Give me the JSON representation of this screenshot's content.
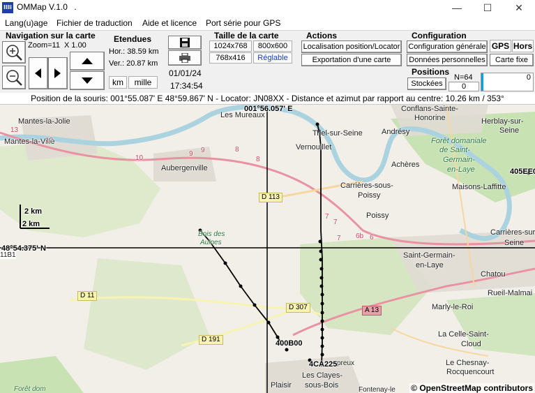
{
  "window": {
    "icon_text": "IIIi",
    "title": "OMMap V.1.0",
    "title_dot": ".",
    "minimize": "—",
    "maximize": "☐",
    "close": "✕"
  },
  "menu": {
    "items": [
      "Lang(u)age",
      "Fichier de traduction",
      "Aide et licence",
      "Port série pour GPS"
    ]
  },
  "navigation": {
    "title": "Navigation sur la carte",
    "zoom_label": "Zoom=11",
    "zoom_factor": "X 1.00",
    "zoom_in_icon": "zoom-in-icon",
    "zoom_out_icon": "zoom-out-icon"
  },
  "extents": {
    "title": "Etendues",
    "hor": "Hor.: 38.59 km",
    "ver": "Ver.: 20.87 km",
    "unit_km": "km",
    "unit_mile": "mille"
  },
  "datetime": {
    "date": "01/01/24",
    "time": "17:34:54"
  },
  "map_size": {
    "title": "Taille de la carte",
    "opt1": "1024x768",
    "opt2": "800x600",
    "opt3": "768x416",
    "opt4": "Réglable"
  },
  "actions": {
    "title": "Actions",
    "locate": "Localisation position/Locator",
    "export": "Exportation d'une carte"
  },
  "configuration": {
    "title": "Configuration",
    "general": "Configuration générale",
    "personal": "Données personnelles",
    "gps": "GPS",
    "hors": "Hors",
    "fixed": "Carte fixe"
  },
  "positions": {
    "title": "Positions",
    "stored": "Stockées",
    "count": "N=64",
    "index": "0",
    "slider_value": "0"
  },
  "infobar": {
    "text": "Position de la souris: 001°55.087' E 48°59.867' N - Locator: JN08XX - Distance et azimut par rapport au centre: 10.26 km / 353°"
  },
  "map": {
    "crosshair_lon": "001°56.057' E",
    "crosshair_lat": "48°54.375' N",
    "scale_label": "2 km",
    "copyright": "© OpenStreetMap contributors",
    "places": {
      "les_mureaux": "Les Mureaux",
      "mantes_la_jolie": "Mantes-la-Jolie",
      "mantes_la_ville": "Mantes-la-Ville",
      "aubergenville": "Aubergenville",
      "triel": "Triel-sur-Seine",
      "vernouillet": "Vernouillet",
      "andresy": "Andrésy",
      "conflans": "Conflans-Sainte-",
      "conflans2": "Honorine",
      "herblay": "Herblay-sur-",
      "herblay2": "Seine",
      "acheres": "Achères",
      "carrieres": "Carrières-sous-",
      "carrieres2": "Poissy",
      "poissy": "Poissy",
      "maisons": "Maisons-Laffitte",
      "carrieres_seine": "Carrières-sur-",
      "carrieres_seine2": "Seine",
      "st_germain": "Saint-Germain-",
      "st_germain2": "en-Laye",
      "chatou": "Chatou",
      "rueil": "Rueil-Malmai",
      "marly": "Marly-le-Roi",
      "celle": "La Celle-Saint-",
      "celle2": "Cloud",
      "chesnay": "Le Chesnay-",
      "chesnay2": "Rocquencourt",
      "plaisir": "Plaisir",
      "clayes": "Les Clayes-",
      "clayes2": "sous-Bois",
      "fontenay": "Fontenay-le",
      "bois_aulnes": "Bois des",
      "bois_aulnes2": "Aulnes",
      "foret_dot": "Forêt dom",
      "forest1": "Forêt domaniale",
      "forest2": "de Saint-",
      "forest3": "Germain-",
      "forest4": "en-Laye",
      "prepreux": "preux",
      "station_1181": "11B1"
    },
    "roads": {
      "d113": "D 113",
      "d11": "D 11",
      "d307": "D 307",
      "d191": "D 191",
      "a13": "A 13",
      "n13": "13",
      "n12": "12",
      "n10": "10",
      "n9a": "9",
      "n9b": "9",
      "n8a": "8",
      "n8b": "8",
      "n7a": "7",
      "n7b": "7",
      "n6b": "6b",
      "n6": "6",
      "n7c": "7"
    },
    "markers": {
      "m1": "400B00",
      "m2": "4CA225",
      "m3": "405EE0"
    }
  }
}
